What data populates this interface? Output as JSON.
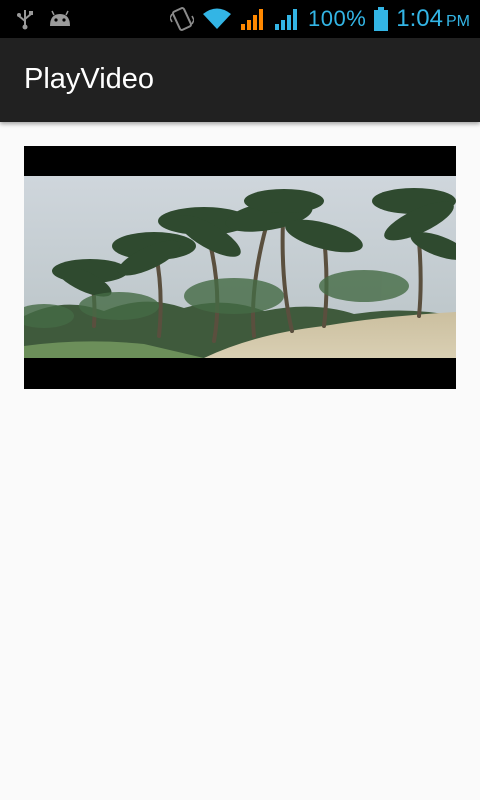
{
  "status_bar": {
    "battery": "100%",
    "time": "1:04",
    "ampm": "PM",
    "icons": [
      "usb-icon",
      "android-icon",
      "vibrate-icon",
      "wifi-icon",
      "signal-icon-1",
      "signal-icon-2",
      "battery-icon"
    ],
    "accent_color": "#33b5e5",
    "signal_warn_color": "#ff8800"
  },
  "app_bar": {
    "title": "PlayVideo",
    "background": "#212121"
  },
  "video": {
    "scene": "palm trees on a beach under overcast sky"
  }
}
